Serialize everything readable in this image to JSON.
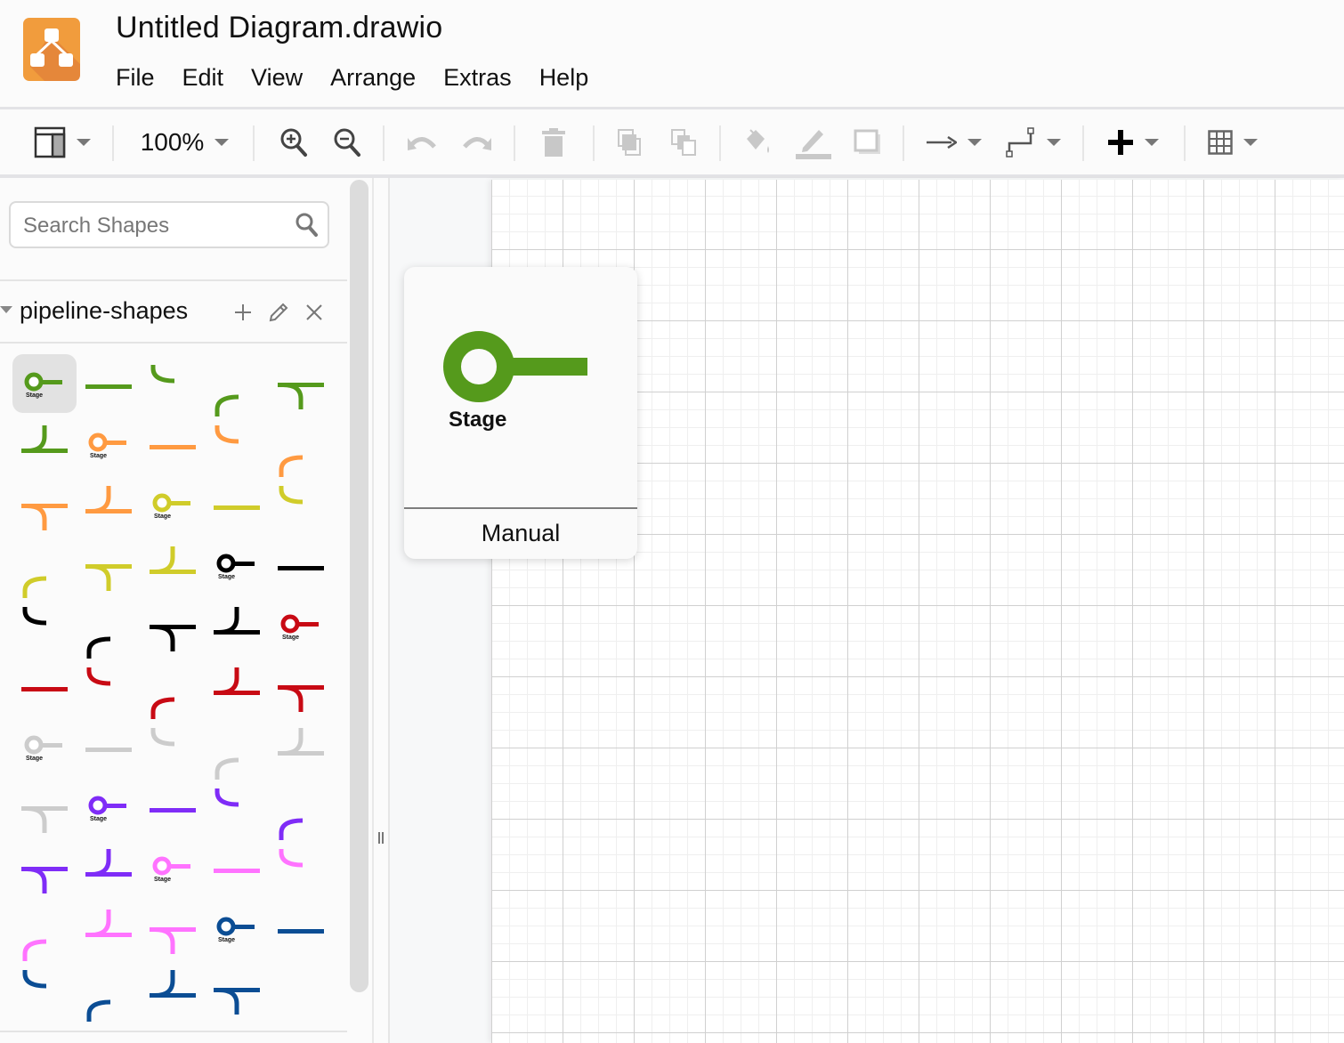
{
  "app": {
    "title": "Untitled Diagram.drawio",
    "logo": "drawio-logo",
    "brand_color": "#f08705"
  },
  "menu": [
    "File",
    "Edit",
    "View",
    "Arrange",
    "Extras",
    "Help"
  ],
  "toolbar": {
    "zoom_level": "100%",
    "buttons": [
      {
        "name": "format-panel-toggle",
        "icon": "layout-panel-icon",
        "enabled": true,
        "dropdown": true
      },
      {
        "name": "zoom-in",
        "icon": "zoom-in-icon",
        "enabled": true
      },
      {
        "name": "zoom-out",
        "icon": "zoom-out-icon",
        "enabled": true
      },
      {
        "name": "undo",
        "icon": "undo-icon",
        "enabled": false
      },
      {
        "name": "redo",
        "icon": "redo-icon",
        "enabled": false
      },
      {
        "name": "delete",
        "icon": "trash-icon",
        "enabled": false
      },
      {
        "name": "to-front",
        "icon": "bring-to-front-icon",
        "enabled": false
      },
      {
        "name": "to-back",
        "icon": "send-to-back-icon",
        "enabled": false
      },
      {
        "name": "fill-color",
        "icon": "paint-bucket-icon",
        "enabled": false
      },
      {
        "name": "line-color",
        "icon": "pencil-icon",
        "enabled": false
      },
      {
        "name": "shadow",
        "icon": "shadow-icon",
        "enabled": false
      },
      {
        "name": "connection",
        "icon": "arrow-right-icon",
        "enabled": true,
        "dropdown": true
      },
      {
        "name": "waypoints",
        "icon": "orthogonal-connector-icon",
        "enabled": true,
        "dropdown": true
      },
      {
        "name": "insert",
        "icon": "plus-icon",
        "enabled": true,
        "dropdown": true
      },
      {
        "name": "table",
        "icon": "table-grid-icon",
        "enabled": true,
        "dropdown": true
      }
    ]
  },
  "sidebar": {
    "search": {
      "placeholder": "Search Shapes",
      "value": ""
    },
    "library": {
      "title": "pipeline-shapes",
      "actions": [
        "add",
        "edit",
        "close"
      ],
      "stage_label": "Stage",
      "colors": {
        "green": "#559a1c",
        "orange": "#ff9a41",
        "yellow": "#d0cc2a",
        "black": "#000000",
        "red": "#c80a14",
        "gray": "#cccccc",
        "purple": "#7f2cf7",
        "pink": "#ff73ff",
        "blue": "#0b4d94"
      },
      "shapes": [
        {
          "type": "stage",
          "color": "green",
          "selected": true
        },
        {
          "type": "line",
          "color": "green"
        },
        {
          "type": "arc-down",
          "color": "green"
        },
        {
          "type": "arc-up",
          "color": "green"
        },
        {
          "type": "branch",
          "color": "green"
        },
        {
          "type": "merge",
          "color": "green"
        },
        {
          "type": "stage",
          "color": "orange"
        },
        {
          "type": "line",
          "color": "orange"
        },
        {
          "type": "arc-down",
          "color": "orange"
        },
        {
          "type": "arc-up",
          "color": "orange"
        },
        {
          "type": "branch",
          "color": "orange"
        },
        {
          "type": "merge",
          "color": "orange"
        },
        {
          "type": "stage",
          "color": "yellow"
        },
        {
          "type": "line",
          "color": "yellow"
        },
        {
          "type": "arc-down",
          "color": "yellow"
        },
        {
          "type": "arc-up",
          "color": "yellow"
        },
        {
          "type": "branch",
          "color": "yellow"
        },
        {
          "type": "merge",
          "color": "yellow"
        },
        {
          "type": "stage",
          "color": "black"
        },
        {
          "type": "line",
          "color": "black"
        },
        {
          "type": "arc-down",
          "color": "black"
        },
        {
          "type": "arc-up",
          "color": "black"
        },
        {
          "type": "branch",
          "color": "black"
        },
        {
          "type": "merge",
          "color": "black"
        },
        {
          "type": "stage",
          "color": "red"
        },
        {
          "type": "line",
          "color": "red"
        },
        {
          "type": "arc-down",
          "color": "red"
        },
        {
          "type": "arc-up",
          "color": "red"
        },
        {
          "type": "merge",
          "color": "red"
        },
        {
          "type": "branch",
          "color": "red"
        },
        {
          "type": "stage",
          "color": "gray"
        },
        {
          "type": "line",
          "color": "gray"
        },
        {
          "type": "arc-down",
          "color": "gray"
        },
        {
          "type": "arc-up",
          "color": "gray"
        },
        {
          "type": "merge",
          "color": "gray"
        },
        {
          "type": "branch",
          "color": "gray"
        },
        {
          "type": "stage",
          "color": "purple"
        },
        {
          "type": "line",
          "color": "purple"
        },
        {
          "type": "arc-down",
          "color": "purple"
        },
        {
          "type": "arc-up",
          "color": "purple"
        },
        {
          "type": "branch",
          "color": "purple"
        },
        {
          "type": "merge",
          "color": "purple"
        },
        {
          "type": "stage",
          "color": "pink"
        },
        {
          "type": "line",
          "color": "pink"
        },
        {
          "type": "arc-down",
          "color": "pink"
        },
        {
          "type": "arc-up",
          "color": "pink"
        },
        {
          "type": "merge",
          "color": "pink"
        },
        {
          "type": "branch",
          "color": "pink"
        },
        {
          "type": "stage",
          "color": "blue"
        },
        {
          "type": "line",
          "color": "blue"
        },
        {
          "type": "arc-down",
          "color": "blue"
        },
        {
          "type": "arc-up",
          "color": "blue"
        },
        {
          "type": "merge",
          "color": "blue"
        },
        {
          "type": "branch",
          "color": "blue"
        }
      ]
    }
  },
  "preview": {
    "stage_label": "Stage",
    "title": "Manual",
    "color": "#559a1c"
  }
}
